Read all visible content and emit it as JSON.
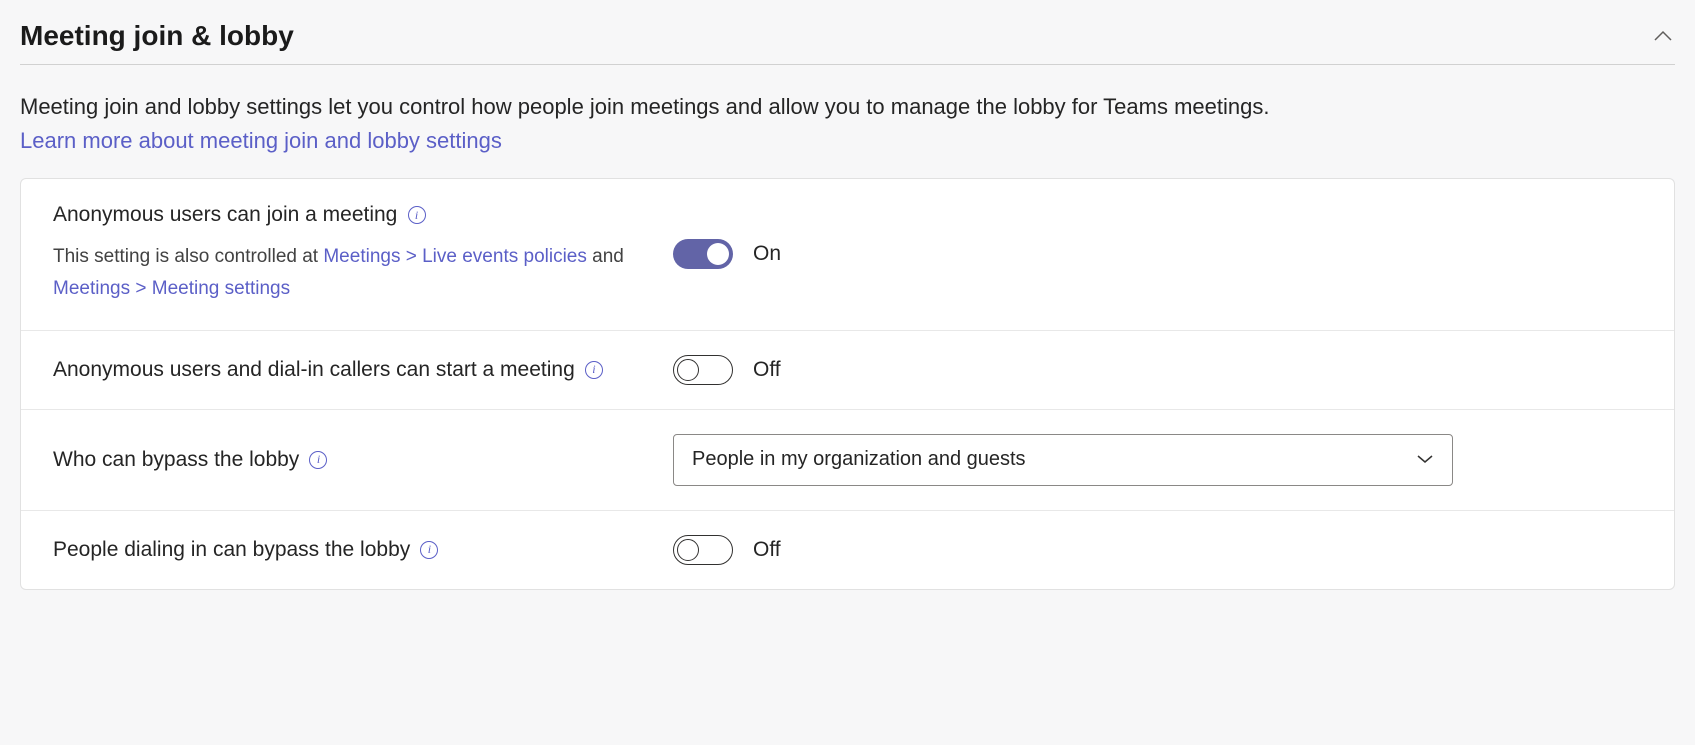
{
  "section": {
    "title": "Meeting join & lobby",
    "description": "Meeting join and lobby settings let you control how people join meetings and allow you to manage the lobby for Teams meetings.",
    "learn_more_text": "Learn more about meeting join and lobby settings"
  },
  "settings": {
    "anonymous_join": {
      "label": "Anonymous users can join a meeting",
      "sublabel_prefix": "This setting is also controlled at ",
      "sublabel_link1": "Meetings > Live events policies",
      "sublabel_and": " and ",
      "sublabel_link2": "Meetings > Meeting settings",
      "state": "On"
    },
    "anonymous_start": {
      "label": "Anonymous users and dial-in callers can start a meeting",
      "state": "Off"
    },
    "bypass_lobby": {
      "label": "Who can bypass the lobby",
      "value": "People in my organization and guests"
    },
    "dialin_bypass": {
      "label": "People dialing in can bypass the lobby",
      "state": "Off"
    }
  }
}
